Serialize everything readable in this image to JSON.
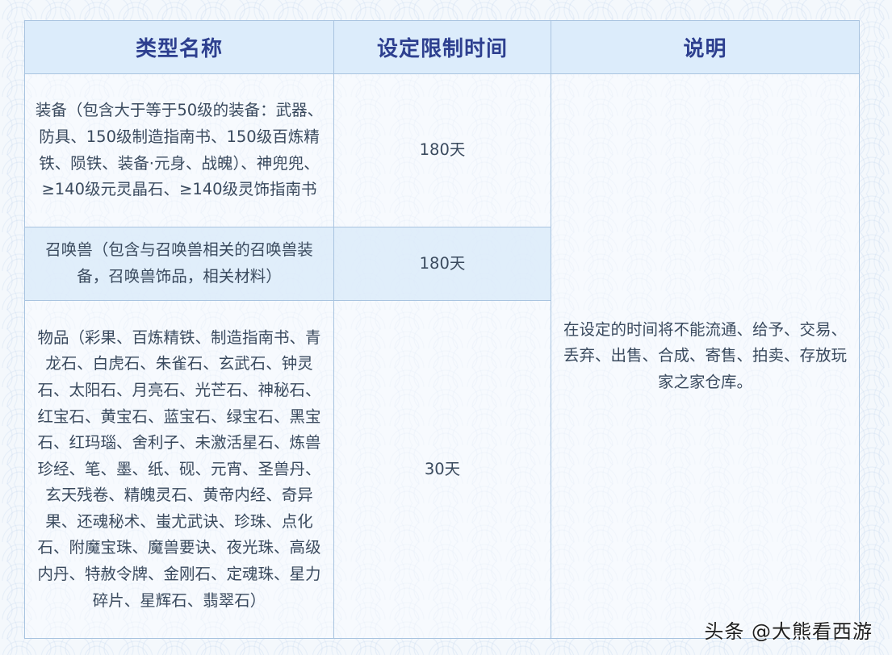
{
  "table": {
    "headers": [
      "类型名称",
      "设定限制时间",
      "说明"
    ],
    "rows": [
      {
        "type": "装备（包含大于等于50级的装备：武器、防具、150级制造指南书、150级百炼精铁、陨铁、装备·元身、战魄）、神兜兜、≥140级元灵晶石、≥140级灵饰指南书",
        "time": "180天"
      },
      {
        "type": "召唤兽（包含与召唤兽相关的召唤兽装备，召唤兽饰品，相关材料）",
        "time": "180天"
      },
      {
        "type": "物品（彩果、百炼精铁、制造指南书、青龙石、白虎石、朱雀石、玄武石、钟灵石、太阳石、月亮石、光芒石、神秘石、红宝石、黄宝石、蓝宝石、绿宝石、黑宝石、红玛瑙、舍利子、未激活星石、炼兽珍经、笔、墨、纸、砚、元宵、圣兽丹、玄天残卷、精魄灵石、黄帝内经、奇异果、还魂秘术、蚩尤武诀、珍珠、点化石、附魔宝珠、魔兽要诀、夜光珠、高级内丹、特赦令牌、金刚石、定魂珠、星力碎片、星辉石、翡翠石）",
        "time": "30天"
      }
    ],
    "description": "在设定的时间将不能流通、给予、交易、丢弃、出售、合成、寄售、拍卖、存放玩家之家仓库。"
  },
  "watermark": "头条 @大熊看西游"
}
